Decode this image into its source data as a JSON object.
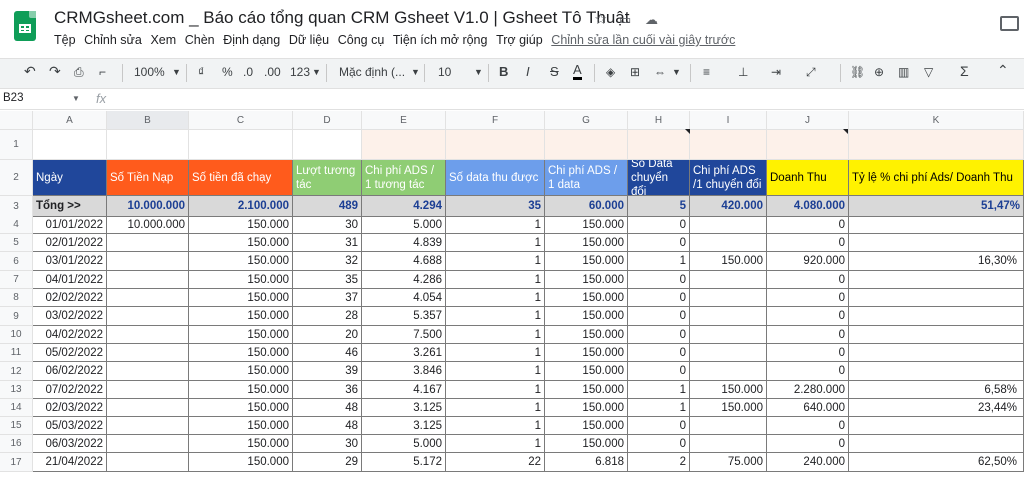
{
  "app": {
    "doc_title": "CRMGsheet.com _ Báo cáo tổng quan CRM Gsheet V1.0 | Gsheet Tô Thuật",
    "menu": [
      "Tệp",
      "Chỉnh sửa",
      "Xem",
      "Chèn",
      "Định dạng",
      "Dữ liệu",
      "Công cụ",
      "Tiện ích mở rộng",
      "Trợ giúp"
    ],
    "last_edit": "Chỉnh sửa lần cuối vài giây trước"
  },
  "toolbar": {
    "zoom": "100%",
    "currency": "₫",
    "percent": "%",
    "dec_decrease": ".0",
    "dec_increase": ".00",
    "format_more": "123",
    "font": "Mặc định (...",
    "font_size": "10",
    "bold": "B",
    "italic": "I",
    "strike": "S",
    "text_color": "A",
    "sum": "Σ"
  },
  "formula_bar": {
    "cell_ref": "B23",
    "fx": "fx",
    "content": ""
  },
  "columns": [
    "A",
    "B",
    "C",
    "D",
    "E",
    "F",
    "G",
    "H",
    "I",
    "J",
    "K"
  ],
  "row_numbers": [
    "1",
    "2",
    "3",
    "4",
    "5",
    "6",
    "7",
    "8",
    "9",
    "10",
    "11",
    "12",
    "13",
    "14",
    "15",
    "16",
    "17"
  ],
  "header_row": [
    "Ngày",
    "Số Tiền Nạp",
    "Số tiền đã chạy",
    "Lượt tương tác",
    "Chi phí ADS / 1 tương tác",
    "Số data thu được",
    "Chi phí ADS / 1 data",
    "Số Data chuyển đổi",
    "Chi phí ADS /1 chuyển đổi",
    "Doanh Thu",
    "Tỷ lệ % chi phí Ads/ Doanh Thu"
  ],
  "header_colors": [
    "#20479b",
    "#ff5b1c",
    "#ff5b1c",
    "#8fcd74",
    "#8fcd74",
    "#6d9eeb",
    "#6d9eeb",
    "#20479b",
    "#20479b",
    "#fff200",
    "#fff200"
  ],
  "total_row": [
    "Tổng >>",
    "10.000.000",
    "2.100.000",
    "489",
    "4.294",
    "35",
    "60.000",
    "5",
    "420.000",
    "4.080.000",
    "51,47%"
  ],
  "rows": [
    [
      "01/01/2022",
      "10.000.000",
      "150.000",
      "30",
      "5.000",
      "1",
      "150.000",
      "0",
      "",
      "0",
      ""
    ],
    [
      "02/01/2022",
      "",
      "150.000",
      "31",
      "4.839",
      "1",
      "150.000",
      "0",
      "",
      "0",
      ""
    ],
    [
      "03/01/2022",
      "",
      "150.000",
      "32",
      "4.688",
      "1",
      "150.000",
      "1",
      "150.000",
      "920.000",
      "16,30%"
    ],
    [
      "04/01/2022",
      "",
      "150.000",
      "35",
      "4.286",
      "1",
      "150.000",
      "0",
      "",
      "0",
      ""
    ],
    [
      "02/02/2022",
      "",
      "150.000",
      "37",
      "4.054",
      "1",
      "150.000",
      "0",
      "",
      "0",
      ""
    ],
    [
      "03/02/2022",
      "",
      "150.000",
      "28",
      "5.357",
      "1",
      "150.000",
      "0",
      "",
      "0",
      ""
    ],
    [
      "04/02/2022",
      "",
      "150.000",
      "20",
      "7.500",
      "1",
      "150.000",
      "0",
      "",
      "0",
      ""
    ],
    [
      "05/02/2022",
      "",
      "150.000",
      "46",
      "3.261",
      "1",
      "150.000",
      "0",
      "",
      "0",
      ""
    ],
    [
      "06/02/2022",
      "",
      "150.000",
      "39",
      "3.846",
      "1",
      "150.000",
      "0",
      "",
      "0",
      ""
    ],
    [
      "07/02/2022",
      "",
      "150.000",
      "36",
      "4.167",
      "1",
      "150.000",
      "1",
      "150.000",
      "2.280.000",
      "6,58%"
    ],
    [
      "02/03/2022",
      "",
      "150.000",
      "48",
      "3.125",
      "1",
      "150.000",
      "1",
      "150.000",
      "640.000",
      "23,44%"
    ],
    [
      "05/03/2022",
      "",
      "150.000",
      "48",
      "3.125",
      "1",
      "150.000",
      "0",
      "",
      "0",
      ""
    ],
    [
      "06/03/2022",
      "",
      "150.000",
      "30",
      "5.000",
      "1",
      "150.000",
      "0",
      "",
      "0",
      ""
    ],
    [
      "21/04/2022",
      "",
      "150.000",
      "29",
      "5.172",
      "22",
      "6.818",
      "2",
      "75.000",
      "240.000",
      "62,50%"
    ]
  ]
}
